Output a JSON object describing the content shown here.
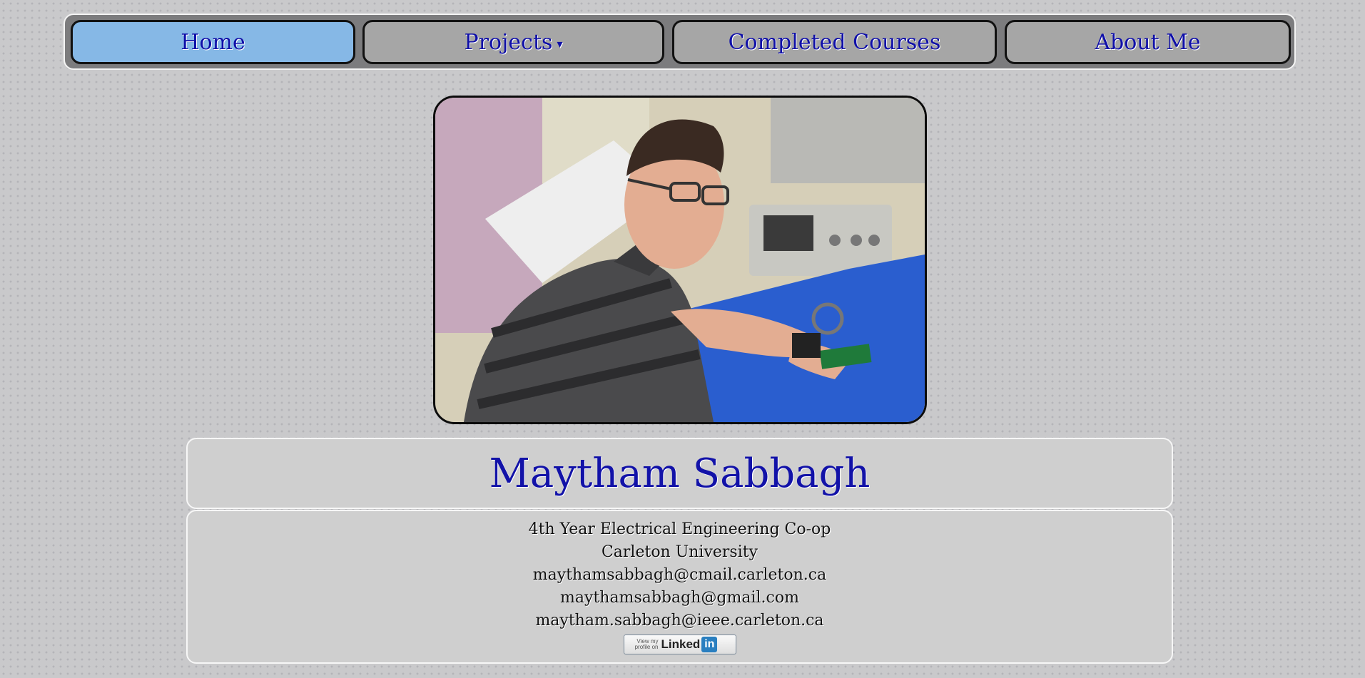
{
  "nav": {
    "items": [
      {
        "label": "Home",
        "active": true
      },
      {
        "label": "Projects",
        "dropdown_indicator": "▾"
      },
      {
        "label": "Completed Courses"
      },
      {
        "label": "About Me"
      }
    ]
  },
  "photo": {
    "description": "person-at-electronics-lab-bench"
  },
  "profile": {
    "name": "Maytham Sabbagh",
    "lines": [
      "4th Year Electrical Engineering Co-op",
      "Carleton University",
      "maythamsabbagh@cmail.carleton.ca",
      "maythamsabbagh@gmail.com",
      "maytham.sabbagh@ieee.carleton.ca"
    ]
  },
  "linkedin_badge": {
    "small_text": "View my profile on",
    "brand": "Linked",
    "brand_in": "in"
  },
  "colors": {
    "nav_active": "#86b8e6",
    "nav_text": "#0f0fa8",
    "name_text": "#1212a8"
  }
}
